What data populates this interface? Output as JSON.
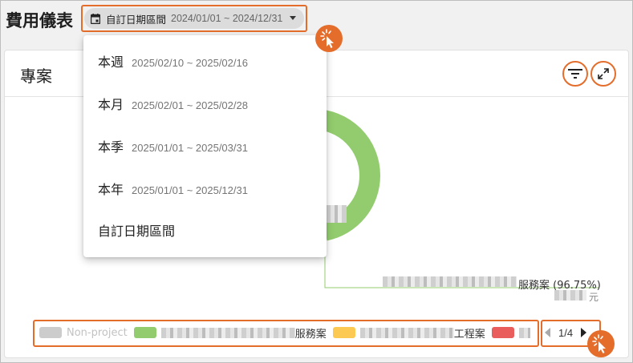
{
  "header": {
    "title": "費用儀表",
    "date_chip": {
      "icon": "calendar-icon",
      "label": "自訂日期區間",
      "range": "2024/01/01 ~ 2024/12/31"
    }
  },
  "card": {
    "title": "專案",
    "actions": [
      {
        "name": "filter-icon"
      },
      {
        "name": "expand-icon"
      }
    ]
  },
  "chart_data": {
    "type": "pie",
    "style": "donut",
    "slices": [
      {
        "label": "服務案",
        "percent": 96.75,
        "color": "#92cc6e"
      }
    ],
    "slice_label": "服務案 (96.75%)",
    "unit": "元"
  },
  "legend": {
    "items": [
      {
        "label": "Non-project",
        "color": "#cccccc",
        "muted": true
      },
      {
        "label": "服務案",
        "color": "#92cc6e"
      },
      {
        "label": "工程案",
        "color": "#fcca52"
      },
      {
        "label": "",
        "color": "#ea5d5d"
      }
    ]
  },
  "pager": {
    "text": "1/4"
  },
  "menu": {
    "items": [
      {
        "label": "本週",
        "range": "2025/02/10 ~ 2025/02/16"
      },
      {
        "label": "本月",
        "range": "2025/02/01 ~ 2025/02/28"
      },
      {
        "label": "本季",
        "range": "2025/01/01 ~ 2025/03/31"
      },
      {
        "label": "本年",
        "range": "2025/01/01 ~ 2025/12/31"
      },
      {
        "label": "自訂日期區間",
        "range": ""
      }
    ]
  },
  "colors": {
    "accent": "#e46d2b",
    "donut": "#92cc6e"
  }
}
